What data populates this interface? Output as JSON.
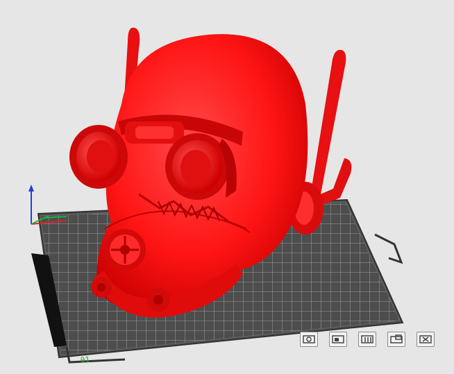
{
  "viewport": {
    "background_color": "#e6e6e6",
    "model_color": "#ff1414",
    "bed_color": "#555555",
    "grid_color": "#9a9a9a",
    "axis_colors": {
      "x": "#e02020",
      "y": "#20b040",
      "z": "#2040d0"
    },
    "bed_label": "01"
  },
  "toolbar": {
    "buttons": [
      {
        "id": "view-iso",
        "icon": "iso-view-icon"
      },
      {
        "id": "view-front",
        "icon": "front-view-icon"
      },
      {
        "id": "view-side",
        "icon": "side-view-icon"
      },
      {
        "id": "view-top",
        "icon": "top-view-icon"
      },
      {
        "id": "view-reset",
        "icon": "close-icon"
      }
    ]
  }
}
